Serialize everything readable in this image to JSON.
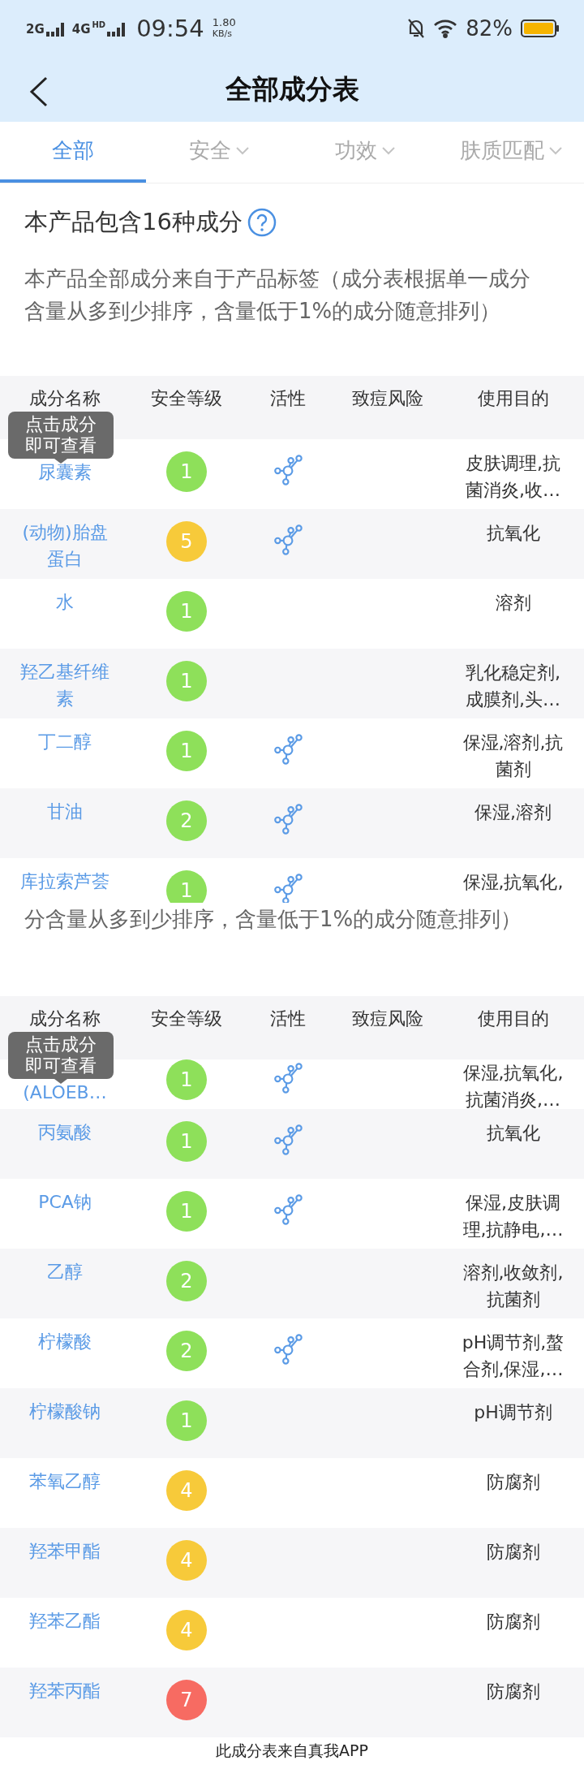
{
  "status_bar": {
    "networks": [
      "2G",
      "4G"
    ],
    "hd": "HD",
    "time": "09:54",
    "speed": "1.80",
    "speed_unit": "KB/s",
    "battery": "82%"
  },
  "header": {
    "title": "全部成分表"
  },
  "tabs": [
    {
      "label": "全部",
      "selected": true,
      "dropdown": false
    },
    {
      "label": "安全",
      "selected": false,
      "dropdown": true
    },
    {
      "label": "功效",
      "selected": false,
      "dropdown": true
    },
    {
      "label": "肤质匹配",
      "selected": false,
      "dropdown": true
    }
  ],
  "summary": {
    "title": "本产品包含16种成分",
    "note": "本产品全部成分来自于产品标签（成分表根据单一成分含量从多到少排序，含量低于1%的成分随意排列）"
  },
  "sections": [
    {
      "columns": [
        "成分名称",
        "安全等级",
        "活性",
        "致痘风险",
        "使用目的"
      ],
      "tooltip": "点击成分即可查看",
      "rows": [
        {
          "kind": "full",
          "name": "尿囊素",
          "grade": "1",
          "color": "#8ee05a",
          "active": true,
          "purpose": "皮肤调理,抗菌消炎,收…"
        },
        {
          "kind": "full",
          "name": "(动物)胎盘蛋白",
          "grade": "5",
          "color": "#f7ca3a",
          "active": true,
          "purpose": "抗氧化"
        },
        {
          "kind": "full",
          "name": "水",
          "grade": "1",
          "color": "#8ee05a",
          "active": false,
          "purpose": "溶剂"
        },
        {
          "kind": "full",
          "name": "羟乙基纤维素",
          "grade": "1",
          "color": "#8ee05a",
          "active": false,
          "purpose": "乳化稳定剂,成膜剂,头…"
        },
        {
          "kind": "full",
          "name": "丁二醇",
          "grade": "1",
          "color": "#8ee05a",
          "active": true,
          "purpose": "保湿,溶剂,抗菌剂"
        },
        {
          "kind": "full",
          "name": "甘油",
          "grade": "2",
          "color": "#8ee05a",
          "active": true,
          "purpose": "保湿,溶剂"
        },
        {
          "kind": "cut_bottom",
          "name": "库拉索芦荟",
          "grade": "1",
          "color": "#8ee05a",
          "active": true,
          "purpose": "保湿,抗氧化,"
        }
      ]
    },
    {
      "note": "分含量从多到少排序，含量低于1%的成分随意排列）",
      "columns": [
        "成分名称",
        "安全等级",
        "活性",
        "致痘风险",
        "使用目的"
      ],
      "tooltip": "点击成分即可查看",
      "rows": [
        {
          "kind": "cut_top",
          "name": "(ALOEB…",
          "grade": "1",
          "color": "#8ee05a",
          "active": true,
          "purpose": "保湿,抗氧化,抗菌消炎,…"
        },
        {
          "kind": "full",
          "name": "丙氨酸",
          "grade": "1",
          "color": "#8ee05a",
          "active": true,
          "purpose": "抗氧化"
        },
        {
          "kind": "full",
          "name": "PCA钠",
          "grade": "1",
          "color": "#8ee05a",
          "active": true,
          "purpose": "保湿,皮肤调理,抗静电,…"
        },
        {
          "kind": "full",
          "name": "乙醇",
          "grade": "2",
          "color": "#8ee05a",
          "active": false,
          "purpose": "溶剂,收敛剂,抗菌剂"
        },
        {
          "kind": "full",
          "name": "柠檬酸",
          "grade": "2",
          "color": "#8ee05a",
          "active": true,
          "purpose": "pH调节剂,螯合剂,保湿,…"
        },
        {
          "kind": "full",
          "name": "柠檬酸钠",
          "grade": "1",
          "color": "#8ee05a",
          "active": false,
          "purpose": "pH调节剂"
        },
        {
          "kind": "full",
          "name": "苯氧乙醇",
          "grade": "4",
          "color": "#f7ca3a",
          "active": false,
          "purpose": "防腐剂"
        },
        {
          "kind": "full",
          "name": "羟苯甲酯",
          "grade": "4",
          "color": "#f7ca3a",
          "active": false,
          "purpose": "防腐剂"
        },
        {
          "kind": "full",
          "name": "羟苯乙酯",
          "grade": "4",
          "color": "#f7ca3a",
          "active": false,
          "purpose": "防腐剂"
        },
        {
          "kind": "full",
          "name": "羟苯丙酯",
          "grade": "7",
          "color": "#f76b62",
          "active": false,
          "purpose": "防腐剂"
        }
      ]
    }
  ],
  "footer": "此成分表来自真我APP"
}
